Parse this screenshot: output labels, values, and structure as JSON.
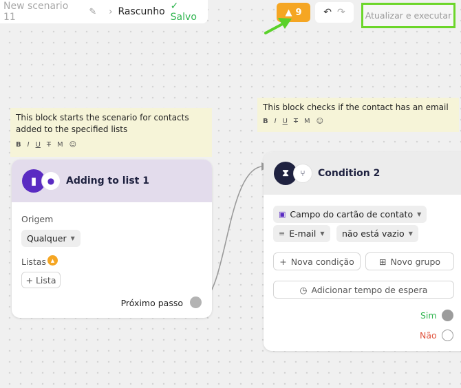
{
  "topbar": {
    "scenario_name": "New scenario 11",
    "draft_label": "Rascunho",
    "saved_label": "Salvo",
    "warning_count": "9",
    "run_label": "Atualizar e executar"
  },
  "colors": {
    "accent_purple": "#5a2bc2",
    "warning_orange": "#f5a623",
    "success_green": "#2eb44e",
    "error_red": "#e0533d",
    "highlight_green": "#6cd62a"
  },
  "notes": {
    "trigger": {
      "text": "This block starts the scenario for contacts added to the specified lists",
      "toolbar": [
        "B",
        "I",
        "U",
        "T",
        "M",
        "☺"
      ]
    },
    "condition": {
      "text": "This block checks if the contact has an email",
      "toolbar": [
        "B",
        "I",
        "U",
        "T",
        "M",
        "☺"
      ]
    }
  },
  "trigger_card": {
    "title": "Adding to list 1",
    "origin_label": "Origem",
    "origin_value": "Qualquer",
    "lists_label": "Listas",
    "add_list_label": "+ Lista",
    "next_step_label": "Próximo passo"
  },
  "condition_card": {
    "title": "Condition 2",
    "field_chip": "Campo do cartão de contato",
    "attribute_chip": "E-mail",
    "operator_chip": "não está vazio",
    "new_condition_label": "Nova condição",
    "new_group_label": "Novo grupo",
    "wait_time_label": "Adicionar tempo de espera",
    "yes_label": "Sim",
    "no_label": "Não"
  }
}
